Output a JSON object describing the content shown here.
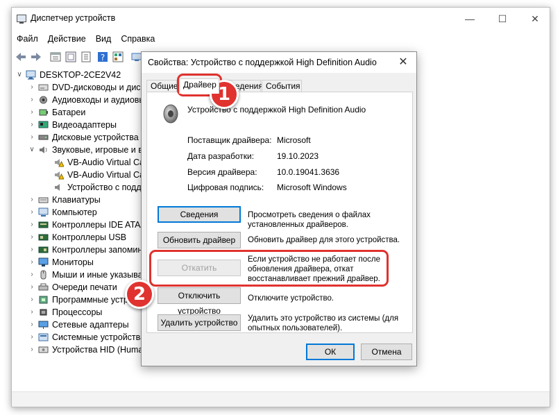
{
  "window": {
    "title": "Диспетчер устройств",
    "menu": [
      "Файл",
      "Действие",
      "Вид",
      "Справка"
    ],
    "caption": {
      "minimize": "—",
      "maximize": "☐",
      "close": "✕"
    }
  },
  "tree": {
    "root": "DESKTOP-2CE2V42",
    "items": [
      {
        "label": "DVD-дисководы и диск",
        "icon": "dvd-drive-icon"
      },
      {
        "label": "Аудиовходы и аудиовы",
        "icon": "audio-io-icon"
      },
      {
        "label": "Батареи",
        "icon": "battery-icon"
      },
      {
        "label": "Видеоадаптеры",
        "icon": "display-adapter-icon"
      },
      {
        "label": "Дисковые устройства",
        "icon": "disk-drive-icon"
      },
      {
        "label": "Звуковые, игровые и в",
        "icon": "sound-icon",
        "expanded": true
      },
      {
        "label": "VB-Audio Virtual Cal",
        "icon": "warning-speaker-icon",
        "child": true
      },
      {
        "label": "VB-Audio Virtual Cal",
        "icon": "warning-speaker-icon",
        "child": true
      },
      {
        "label": "Устройство с подде",
        "icon": "speaker-icon",
        "child": true
      },
      {
        "label": "Клавиатуры",
        "icon": "keyboard-icon"
      },
      {
        "label": "Компьютер",
        "icon": "computer-icon"
      },
      {
        "label": "Контроллеры IDE ATA/",
        "icon": "ide-controller-icon"
      },
      {
        "label": "Контроллеры USB",
        "icon": "usb-icon"
      },
      {
        "label": "Контроллеры запомин",
        "icon": "storage-controller-icon"
      },
      {
        "label": "Мониторы",
        "icon": "monitor-icon"
      },
      {
        "label": "Мыши и иные указыва",
        "icon": "mouse-icon"
      },
      {
        "label": "Очереди печати",
        "icon": "printer-icon"
      },
      {
        "label": "Программные устрой",
        "icon": "software-device-icon"
      },
      {
        "label": "Процессоры",
        "icon": "processor-icon"
      },
      {
        "label": "Сетевые адаптеры",
        "icon": "network-adapter-icon"
      },
      {
        "label": "Системные устройства",
        "icon": "system-device-icon"
      },
      {
        "label": "Устройства HID (Huma",
        "icon": "hid-icon"
      }
    ]
  },
  "dialog": {
    "title": "Свойства: Устройство с поддержкой High Definition Audio",
    "close": "✕",
    "tabs": [
      "Общие",
      "Драйвер",
      "Сведения",
      "События"
    ],
    "active_tab": "Драйвер",
    "device_name": "Устройство с поддержкой High Definition Audio",
    "props": [
      {
        "label": "Поставщик драйвера:",
        "value": "Microsoft"
      },
      {
        "label": "Дата разработки:",
        "value": "19.10.2023"
      },
      {
        "label": "Версия драйвера:",
        "value": "10.0.19041.3636"
      },
      {
        "label": "Цифровая подпись:",
        "value": "Microsoft Windows"
      }
    ],
    "actions": {
      "details": {
        "label": "Сведения",
        "desc": "Просмотреть сведения о файлах установленных драйверов."
      },
      "update": {
        "label": "Обновить драйвер",
        "desc": "Обновить драйвер для этого устройства."
      },
      "rollback": {
        "label": "Откатить",
        "desc": "Если устройство не работает после обновления драйвера, откат восстанавливает прежний драйвер.",
        "disabled": true
      },
      "disable": {
        "label": "Отключить устройство",
        "desc": "Отключите устройство."
      },
      "uninstall": {
        "label": "Удалить устройство",
        "desc": "Удалить это устройство из системы (для опытных пользователей)."
      }
    },
    "ok": "ОК",
    "cancel": "Отмена"
  },
  "annotations": {
    "step1": "1",
    "step2": "2",
    "color": "#e0322f"
  }
}
